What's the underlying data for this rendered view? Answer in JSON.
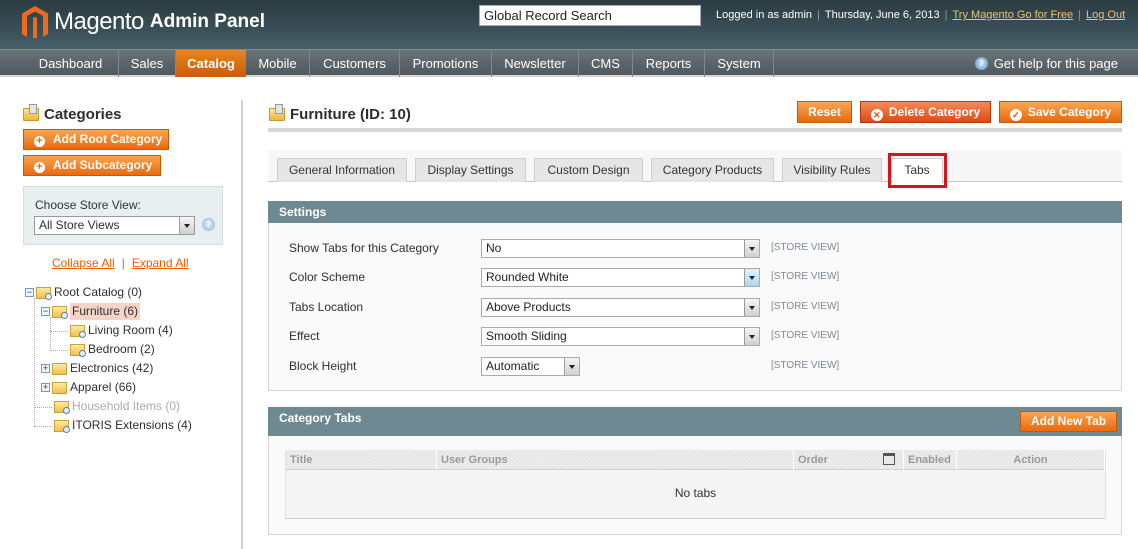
{
  "header": {
    "app_name": "Magento",
    "app_subtitle": "Admin Panel",
    "search_placeholder": "Global Record Search",
    "logged_in": "Logged in as admin",
    "date": "Thursday, June 6, 2013",
    "try_link": "Try Magento Go for Free",
    "logout": "Log Out"
  },
  "nav": {
    "items": [
      "Dashboard",
      "Sales",
      "Catalog",
      "Mobile",
      "Customers",
      "Promotions",
      "Newsletter",
      "CMS",
      "Reports",
      "System"
    ],
    "active": "Catalog",
    "help": "Get help for this page"
  },
  "sidebar": {
    "title": "Categories",
    "add_root": "Add Root Category",
    "add_sub": "Add Subcategory",
    "store_label": "Choose Store View:",
    "store_value": "All Store Views",
    "collapse_all": "Collapse All",
    "expand_all": "Expand All",
    "tree": [
      {
        "label": "Root Catalog (0)",
        "toggle": "minus"
      },
      {
        "label": "Furniture (6)",
        "toggle": "minus",
        "selected": true
      },
      {
        "label": "Living Room (4)"
      },
      {
        "label": "Bedroom (2)"
      },
      {
        "label": "Electronics (42)",
        "toggle": "plus"
      },
      {
        "label": "Apparel (66)",
        "toggle": "plus"
      },
      {
        "label": "Household Items (0)",
        "disabled": true
      },
      {
        "label": "ITORIS Extensions (4)"
      }
    ]
  },
  "main": {
    "title": "Furniture (ID: 10)",
    "buttons": {
      "reset": "Reset",
      "delete": "Delete Category",
      "save": "Save Category"
    },
    "tabs": [
      "General Information",
      "Display Settings",
      "Custom Design",
      "Category Products",
      "Visibility Rules",
      "Tabs"
    ],
    "active_tab": "Tabs",
    "settings": {
      "title": "Settings",
      "fields": [
        {
          "label": "Show Tabs for this Category",
          "value": "No",
          "scope": "[STORE VIEW]"
        },
        {
          "label": "Color Scheme",
          "value": "Rounded White",
          "scope": "[STORE VIEW]"
        },
        {
          "label": "Tabs Location",
          "value": "Above Products",
          "scope": "[STORE VIEW]"
        },
        {
          "label": "Effect",
          "value": "Smooth Sliding",
          "scope": "[STORE VIEW]"
        },
        {
          "label": "Block Height",
          "value": "Automatic",
          "scope": "[STORE VIEW]"
        }
      ]
    },
    "category_tabs": {
      "title": "Category Tabs",
      "add_button": "Add New Tab",
      "columns": [
        "Title",
        "User Groups",
        "Order",
        "Enabled",
        "Action"
      ],
      "empty": "No tabs"
    }
  },
  "colors": {
    "accent_orange": "#ea6a0c",
    "panel_header": "#6f8992",
    "highlight_red": "#d8131b"
  }
}
